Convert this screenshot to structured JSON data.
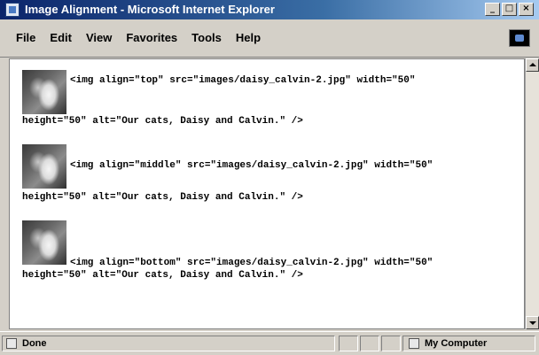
{
  "window": {
    "title": "Image Alignment - Microsoft Internet Explorer"
  },
  "window_buttons": {
    "minimize": "_",
    "maximize": "□",
    "close": "×"
  },
  "menu": [
    {
      "label": "File"
    },
    {
      "label": "Edit"
    },
    {
      "label": "View"
    },
    {
      "label": "Favorites"
    },
    {
      "label": "Tools"
    },
    {
      "label": "Help"
    }
  ],
  "content": {
    "examples": [
      {
        "line1": "<img align=\"top\" src=\"images/daisy_calvin-2.jpg\" width=\"50\"",
        "line2": "height=\"50\" alt=\"Our cats, Daisy and Calvin.\" />"
      },
      {
        "line1": "<img align=\"middle\" src=\"images/daisy_calvin-2.jpg\" width=\"50\"",
        "line2": "height=\"50\" alt=\"Our cats, Daisy and Calvin.\" />"
      },
      {
        "line1": "<img align=\"bottom\" src=\"images/daisy_calvin-2.jpg\" width=\"50\"",
        "line2": "height=\"50\" alt=\"Our cats, Daisy and Calvin.\" />"
      }
    ]
  },
  "statusbar": {
    "status": "Done",
    "zone": "My Computer"
  }
}
